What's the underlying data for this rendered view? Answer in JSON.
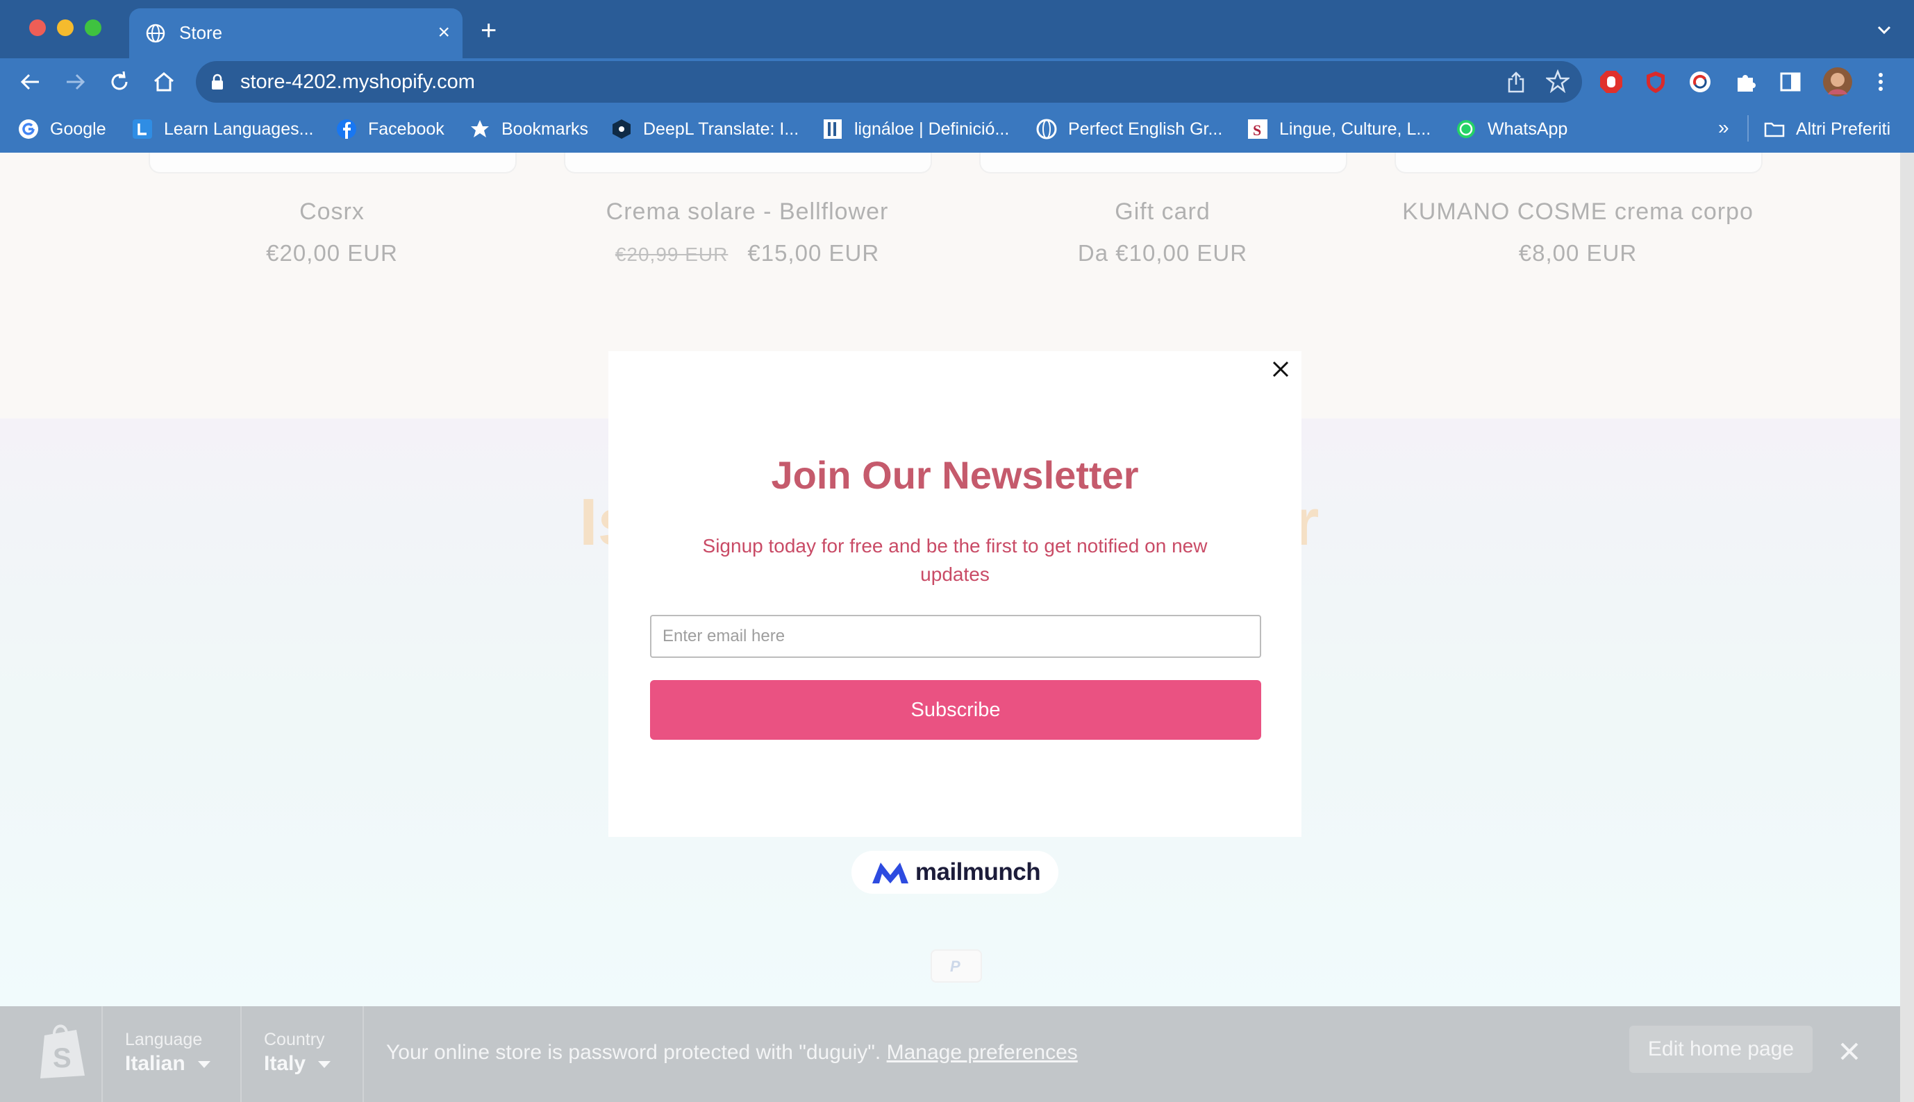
{
  "browser": {
    "tab_title": "Store",
    "new_tab_label": "+",
    "url": "store-4202.myshopify.com",
    "bookmarks": [
      {
        "label": "Google",
        "icon": "google-icon"
      },
      {
        "label": "Learn Languages...",
        "icon": "learn-languages-icon"
      },
      {
        "label": "Facebook",
        "icon": "facebook-icon"
      },
      {
        "label": "Bookmarks",
        "icon": "star-icon"
      },
      {
        "label": "DeepL Translate: I...",
        "icon": "deepl-icon"
      },
      {
        "label": "lignáloe | Definició...",
        "icon": "rae-icon"
      },
      {
        "label": "Perfect English Gr...",
        "icon": "globe-icon"
      },
      {
        "label": "Lingue, Culture, L...",
        "icon": "unibo-icon"
      },
      {
        "label": "WhatsApp",
        "icon": "whatsapp-icon"
      }
    ],
    "bookmarks_overflow": "»",
    "other_bookmarks": "Altri Preferiti"
  },
  "products": [
    {
      "name": "Cosrx",
      "price": "€20,00 EUR",
      "old_price": ""
    },
    {
      "name": "Crema solare - Bellflower",
      "price": "€15,00 EUR",
      "old_price": "€20,99 EUR"
    },
    {
      "name": "Gift card",
      "price": "Da €10,00 EUR",
      "old_price": ""
    },
    {
      "name": "KUMANO COSME crema corpo",
      "price": "€8,00 EUR",
      "old_price": ""
    }
  ],
  "background_heading": {
    "left": "Is",
    "right": "r"
  },
  "newsletter": {
    "title": "Join Our Newsletter",
    "subtitle": "Signup today for free and be the first to get notified on new updates",
    "email_placeholder": "Enter email here",
    "email_value": "",
    "submit_label": "Subscribe",
    "badge_text": "mailmunch"
  },
  "shopify_bar": {
    "language_label": "Language",
    "language_value": "Italian",
    "country_label": "Country",
    "country_value": "Italy",
    "message": "Your online store is password protected with \"duguiy\".",
    "link_text": "Manage preferences",
    "edit_button": "Edit home page"
  },
  "colors": {
    "browser_frame": "#2a5c97",
    "browser_toolbar": "#3a78bf",
    "newsletter_title": "#c55a6c",
    "subscribe_button": "#ea5282",
    "shopify_bar": "#c2c6c9"
  }
}
